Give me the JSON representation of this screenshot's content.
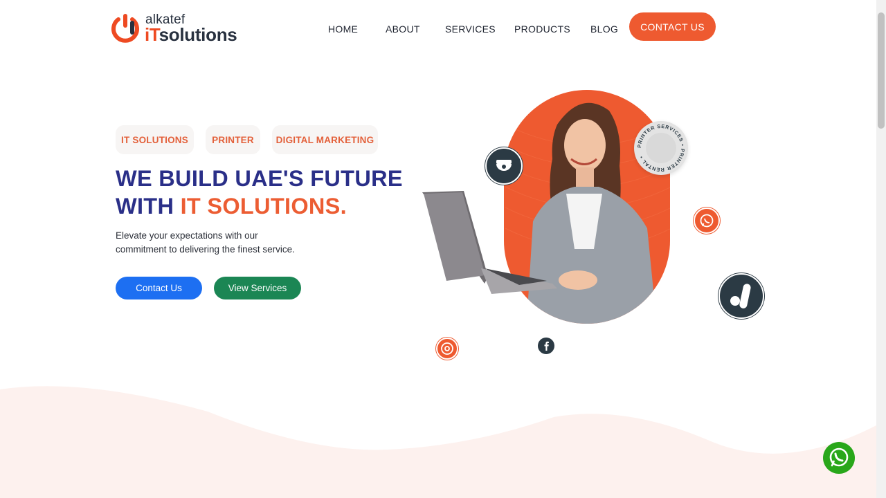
{
  "brand": {
    "name_small": "alkatef",
    "name_big_prefix": "iT",
    "name_big_rest": "solutions",
    "accent_color": "#ee5a30",
    "dark_color": "#28313f"
  },
  "nav": {
    "items": [
      "HOME",
      "ABOUT",
      "SERVICES",
      "PRODUCTS",
      "BLOG"
    ],
    "contact_label": "CONTACT US"
  },
  "hero": {
    "tags": [
      "IT SOLUTIONS",
      "PRINTER",
      "DIGITAL MARKETING"
    ],
    "headline_line1": "WE BUILD UAE'S FUTURE",
    "headline_line2_prefix": "WITH ",
    "headline_line2_accent": "IT SOLUTIONS.",
    "subtitle_line1": "Elevate your expectations with our",
    "subtitle_line2": "commitment to delivering the finest service.",
    "primary_button": "Contact Us",
    "secondary_button": "View Services",
    "primary_color": "#1d6ff2",
    "secondary_color": "#1b8654",
    "rental_badge_text": "PRINTER SERVICES • PRINTER RENTAL •"
  },
  "floating_icons": [
    "cctv-camera-icon",
    "whatsapp-icon",
    "google-ads-icon",
    "target-icon",
    "facebook-icon",
    "whatsapp-chat-icon"
  ]
}
